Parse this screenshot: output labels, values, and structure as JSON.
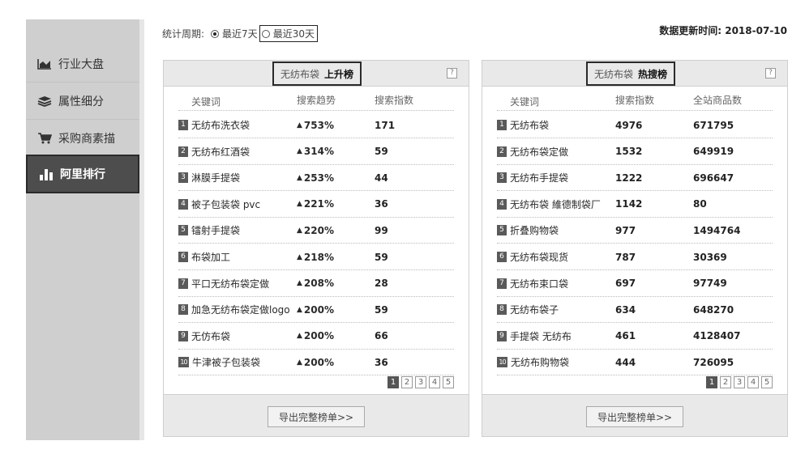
{
  "sidebar": {
    "items": [
      {
        "label": "行业大盘",
        "icon": "area-chart-icon",
        "active": false
      },
      {
        "label": "属性细分",
        "icon": "layers-icon",
        "active": false
      },
      {
        "label": "采购商素描",
        "icon": "cart-icon",
        "active": false
      },
      {
        "label": "阿里排行",
        "icon": "bar-chart-icon",
        "active": true
      }
    ]
  },
  "period": {
    "label": "统计周期:",
    "options": [
      {
        "label": "最近7天",
        "selected": true
      },
      {
        "label": "最近30天",
        "selected": false
      }
    ]
  },
  "update": {
    "label": "数据更新时间:",
    "value": "2018-07-10"
  },
  "rising": {
    "prefix": "无纺布袋",
    "title": "上升榜",
    "columns": [
      "关键词",
      "搜索趋势",
      "搜索指数"
    ],
    "rows": [
      {
        "rank": "1",
        "keyword": "无纺布洗衣袋",
        "trend": "753%",
        "index": "171"
      },
      {
        "rank": "2",
        "keyword": "无纺布红酒袋",
        "trend": "314%",
        "index": "59"
      },
      {
        "rank": "3",
        "keyword": "淋膜手提袋",
        "trend": "253%",
        "index": "44"
      },
      {
        "rank": "4",
        "keyword": "被子包装袋 pvc",
        "trend": "221%",
        "index": "36"
      },
      {
        "rank": "5",
        "keyword": "镭射手提袋",
        "trend": "220%",
        "index": "99"
      },
      {
        "rank": "6",
        "keyword": "布袋加工",
        "trend": "218%",
        "index": "59"
      },
      {
        "rank": "7",
        "keyword": "平口无纺布袋定做",
        "trend": "208%",
        "index": "28"
      },
      {
        "rank": "8",
        "keyword": "加急无纺布袋定做logo",
        "trend": "200%",
        "index": "59"
      },
      {
        "rank": "9",
        "keyword": "无仿布袋",
        "trend": "200%",
        "index": "66"
      },
      {
        "rank": "10",
        "keyword": "牛津被子包装袋",
        "trend": "200%",
        "index": "36"
      }
    ],
    "pages": [
      "1",
      "2",
      "3",
      "4",
      "5"
    ],
    "export": "导出完整榜单>>"
  },
  "hot": {
    "prefix": "无纺布袋",
    "title": "热搜榜",
    "columns": [
      "关键词",
      "搜索指数",
      "全站商品数"
    ],
    "rows": [
      {
        "rank": "1",
        "keyword": "无纺布袋",
        "index": "4976",
        "count": "671795"
      },
      {
        "rank": "2",
        "keyword": "无纺布袋定做",
        "index": "1532",
        "count": "649919"
      },
      {
        "rank": "3",
        "keyword": "无纺布手提袋",
        "index": "1222",
        "count": "696647"
      },
      {
        "rank": "4",
        "keyword": "无纺布袋 維德制袋厂",
        "index": "1142",
        "count": "80"
      },
      {
        "rank": "5",
        "keyword": "折叠购物袋",
        "index": "977",
        "count": "1494764"
      },
      {
        "rank": "6",
        "keyword": "无纺布袋现货",
        "index": "787",
        "count": "30369"
      },
      {
        "rank": "7",
        "keyword": "无纺布束口袋",
        "index": "697",
        "count": "97749"
      },
      {
        "rank": "8",
        "keyword": "无纺布袋子",
        "index": "634",
        "count": "648270"
      },
      {
        "rank": "9",
        "keyword": "手提袋 无纺布",
        "index": "461",
        "count": "4128407"
      },
      {
        "rank": "10",
        "keyword": "无纺布购物袋",
        "index": "444",
        "count": "726095"
      }
    ],
    "pages": [
      "1",
      "2",
      "3",
      "4",
      "5"
    ],
    "export": "导出完整榜单>>"
  },
  "help_glyph": "?"
}
